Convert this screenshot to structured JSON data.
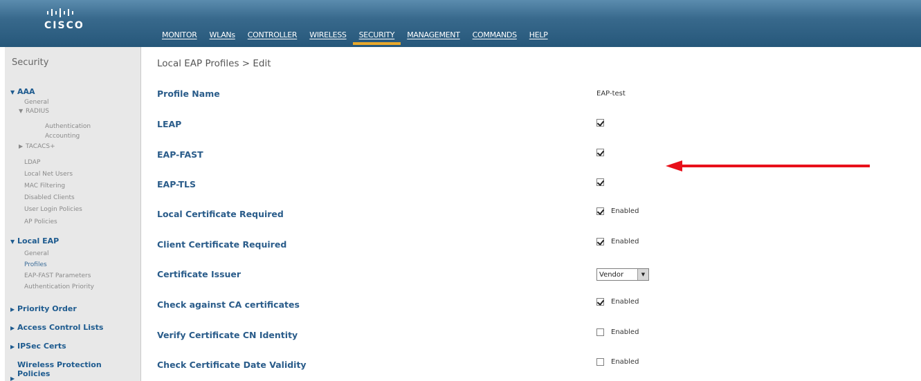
{
  "brand": {
    "name": "CISCO"
  },
  "menu": [
    {
      "label": "MONITOR"
    },
    {
      "label": "WLANs"
    },
    {
      "label": "CONTROLLER"
    },
    {
      "label": "WIRELESS"
    },
    {
      "label": "SECURITY"
    },
    {
      "label": "MANAGEMENT"
    },
    {
      "label": "COMMANDS"
    },
    {
      "label": "HELP"
    }
  ],
  "active_menu": "SECURITY",
  "sidebar": {
    "title": "Security",
    "aaa": "AAA",
    "aaa_general": "General",
    "radius": "RADIUS",
    "radius_auth": "Authentication",
    "radius_acct": "Accounting",
    "tacacs": "TACACS+",
    "ldap": "LDAP",
    "local_net_users": "Local Net Users",
    "mac_filtering": "MAC Filtering",
    "disabled_clients": "Disabled Clients",
    "user_login_policies": "User Login Policies",
    "ap_policies": "AP Policies",
    "local_eap": "Local EAP",
    "le_general": "General",
    "le_profiles": "Profiles",
    "le_eap_fast": "EAP-FAST Parameters",
    "le_auth_priority": "Authentication Priority",
    "priority_order": "Priority Order",
    "acl": "Access Control Lists",
    "ipsec": "IPSec Certs",
    "wpp_line1": "Wireless Protection",
    "wpp_line2": "Policies"
  },
  "main": {
    "title": "Local EAP Profiles > Edit",
    "rows": [
      {
        "label": "Profile Name",
        "value": "EAP-test"
      },
      {
        "label": "LEAP",
        "checked": true
      },
      {
        "label": "EAP-FAST",
        "checked": true
      },
      {
        "label": "EAP-TLS",
        "checked": true
      },
      {
        "label": "Local Certificate Required",
        "checked": true,
        "text": "Enabled"
      },
      {
        "label": "Client Certificate Required",
        "checked": true,
        "text": "Enabled"
      },
      {
        "label": "Certificate Issuer",
        "select": "Vendor"
      },
      {
        "label": "Check against CA certificates",
        "checked": true,
        "text": "Enabled"
      },
      {
        "label": "Verify Certificate CN Identity",
        "checked": false,
        "text": "Enabled"
      },
      {
        "label": "Check Certificate Date Validity",
        "checked": false,
        "text": "Enabled"
      }
    ]
  },
  "colors": {
    "header": "#26577a",
    "accent": "#e8a82b",
    "label_blue": "#2a5c8a",
    "arrow": "#e8101a"
  }
}
